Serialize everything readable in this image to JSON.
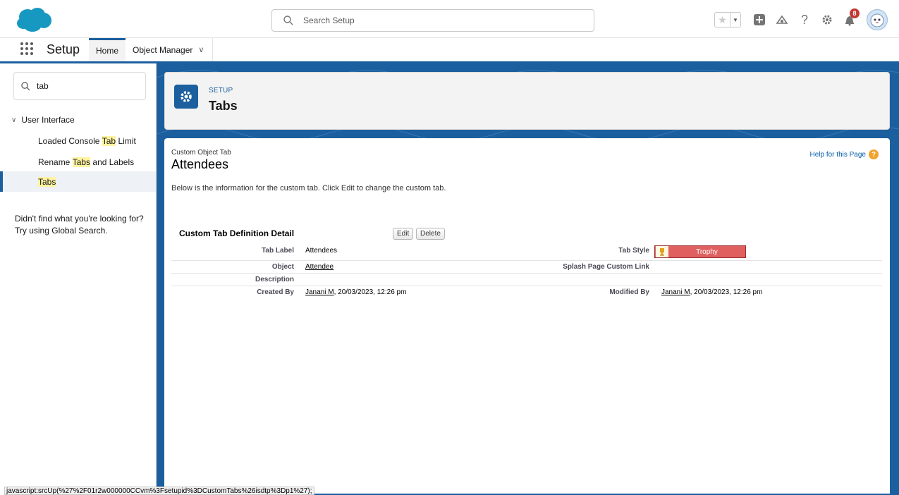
{
  "header": {
    "search_placeholder": "Search Setup",
    "notification_count": "8"
  },
  "nav": {
    "app_name": "Setup",
    "tabs": [
      {
        "label": "Home"
      },
      {
        "label": "Object Manager"
      }
    ]
  },
  "sidebar": {
    "quick_find_value": "tab",
    "section": "User Interface",
    "items": [
      {
        "pre": "Loaded Console ",
        "match": "Tab",
        "post": " Limit"
      },
      {
        "pre": "Rename ",
        "match": "Tabs",
        "post": " and Labels"
      },
      {
        "pre": "",
        "match": "Tabs",
        "post": ""
      }
    ],
    "help_line1": "Didn't find what you're looking for?",
    "help_line2": "Try using Global Search."
  },
  "page_header": {
    "eyebrow": "SETUP",
    "title": "Tabs"
  },
  "content": {
    "object_type": "Custom Object Tab",
    "object_name": "Attendees",
    "help_link": "Help for this Page",
    "intro": "Below is the information for the custom tab. Click Edit to change the custom tab.",
    "detail_title": "Custom Tab Definition Detail",
    "edit_label": "Edit",
    "delete_label": "Delete",
    "fields": {
      "tab_label_label": "Tab Label",
      "tab_label_value": "Attendees",
      "tab_style_label": "Tab Style",
      "tab_style_value": "Trophy",
      "object_label": "Object",
      "object_value": "Attendee",
      "splash_label": "Splash Page Custom Link",
      "description_label": "Description",
      "created_by_label": "Created By",
      "created_by_user": "Janani M",
      "created_by_date": ", 20/03/2023, 12:26 pm",
      "modified_by_label": "Modified By",
      "modified_by_user": "Janani M",
      "modified_by_date": ", 20/03/2023, 12:26 pm"
    }
  },
  "colors": {
    "brand": "#1b5f9e",
    "tab_style": "#e06060",
    "highlight": "#fff3a0"
  },
  "status_bar": "javascript:srcUp(%27%2F01r2w000000CCvm%3Fsetupid%3DCustomTabs%26isdtp%3Dp1%27);"
}
